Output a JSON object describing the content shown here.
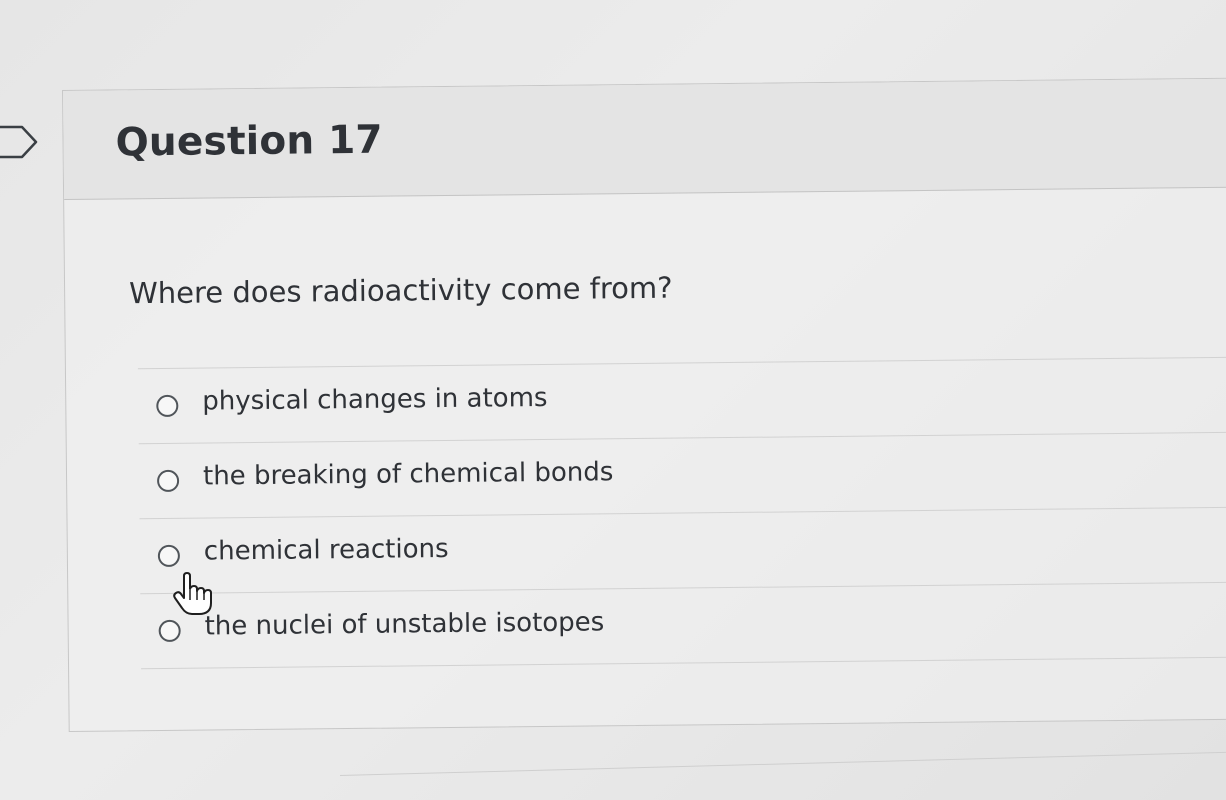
{
  "question": {
    "title": "Question 17",
    "text": "Where does radioactivity come from?",
    "answers": [
      {
        "label": "physical changes in atoms",
        "selected": false
      },
      {
        "label": "the breaking of chemical bonds",
        "selected": false
      },
      {
        "label": "chemical reactions",
        "selected": false
      },
      {
        "label": "the nuclei of unstable isotopes",
        "selected": false
      }
    ]
  },
  "icons": {
    "flag": "flag-outline-icon",
    "radio": "radio-unchecked-icon",
    "cursor": "hand-pointer-cursor-icon"
  },
  "colors": {
    "text": "#2f3237",
    "header_background": "#e4e4e4",
    "border": "#c7c7c7"
  }
}
